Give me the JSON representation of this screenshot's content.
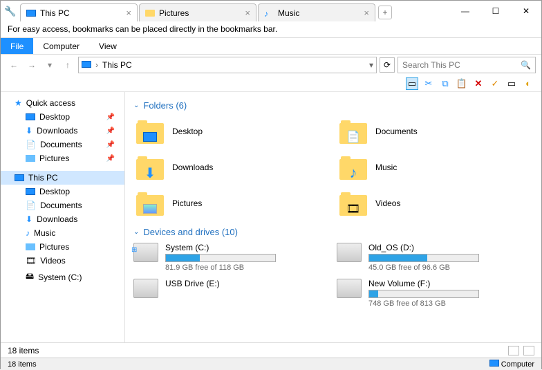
{
  "tabs": [
    {
      "label": "This PC",
      "icon": "monitor"
    },
    {
      "label": "Pictures",
      "icon": "folder"
    },
    {
      "label": "Music",
      "icon": "music"
    }
  ],
  "bookmark_msg": "For easy access, bookmarks can be placed directly in the bookmarks bar.",
  "menu": {
    "file": "File",
    "computer": "Computer",
    "view": "View"
  },
  "address": {
    "location": "This PC"
  },
  "search": {
    "placeholder": "Search This PC"
  },
  "sidebar": {
    "quick_access": "Quick access",
    "qa_items": [
      {
        "label": "Desktop",
        "icon": "desktop",
        "pinned": true
      },
      {
        "label": "Downloads",
        "icon": "downloads",
        "pinned": true
      },
      {
        "label": "Documents",
        "icon": "documents",
        "pinned": true
      },
      {
        "label": "Pictures",
        "icon": "pictures",
        "pinned": true
      }
    ],
    "this_pc": "This PC",
    "pc_items": [
      {
        "label": "Desktop"
      },
      {
        "label": "Documents"
      },
      {
        "label": "Downloads"
      },
      {
        "label": "Music"
      },
      {
        "label": "Pictures"
      },
      {
        "label": "Videos"
      },
      {
        "label": "System (C:)"
      }
    ]
  },
  "content": {
    "folders_hdr": "Folders (6)",
    "folders": [
      {
        "label": "Desktop",
        "overlay": "desktop"
      },
      {
        "label": "Documents",
        "overlay": "doc"
      },
      {
        "label": "Downloads",
        "overlay": "down"
      },
      {
        "label": "Music",
        "overlay": "music"
      },
      {
        "label": "Pictures",
        "overlay": "pic"
      },
      {
        "label": "Videos",
        "overlay": "video"
      }
    ],
    "drives_hdr": "Devices and drives (10)",
    "drives": [
      {
        "label": "System (C:)",
        "free": "81.9 GB free of 118 GB",
        "pct": 31,
        "mini": "win"
      },
      {
        "label": "Old_OS (D:)",
        "free": "45.0 GB free of 96.6 GB",
        "pct": 53,
        "mini": ""
      },
      {
        "label": "USB Drive (E:)",
        "free": "",
        "pct": null,
        "mini": ""
      },
      {
        "label": "New Volume (F:)",
        "free": "748 GB free of 813 GB",
        "pct": 8,
        "mini": ""
      }
    ]
  },
  "status": {
    "items": "18 items",
    "items2": "18 items",
    "computer": "Computer"
  }
}
